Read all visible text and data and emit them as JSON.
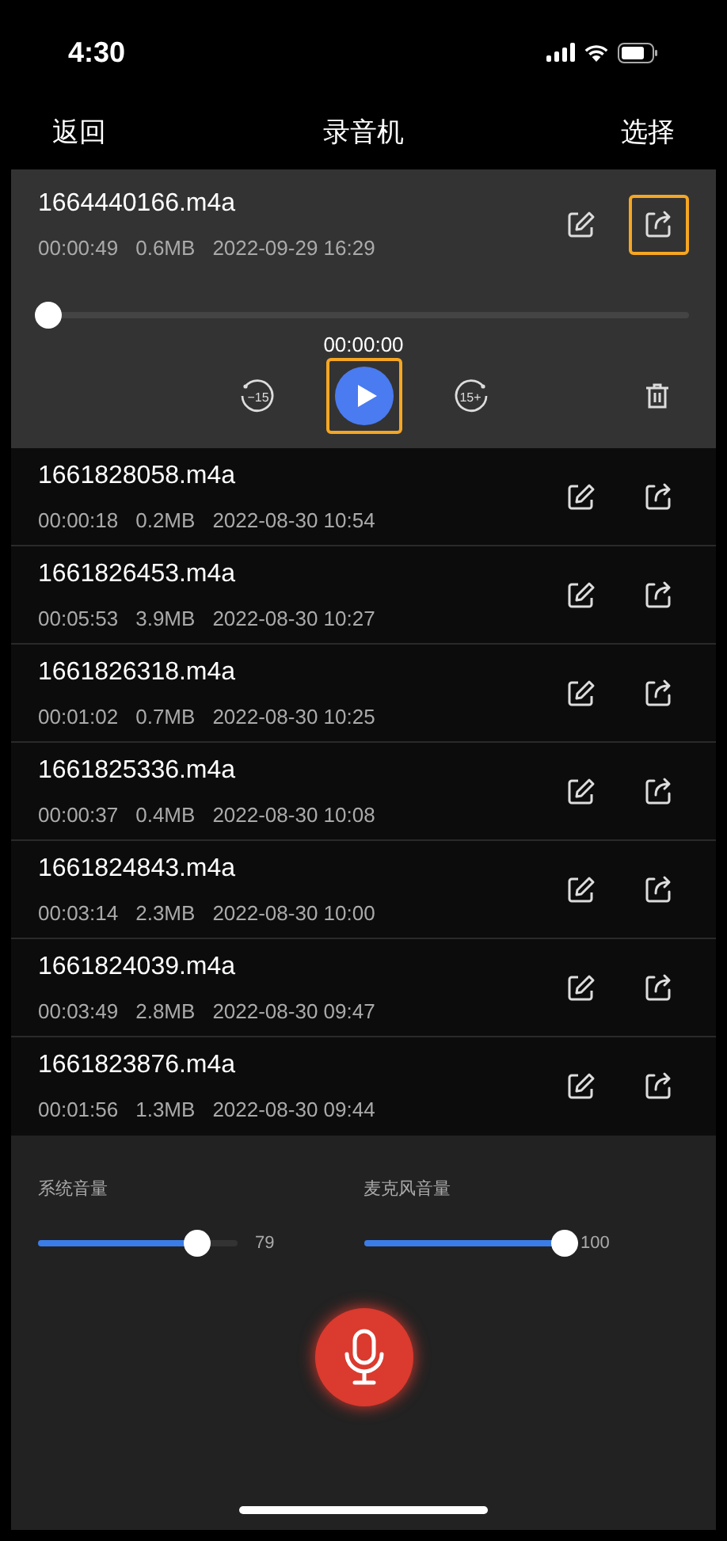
{
  "status_bar": {
    "time": "4:30"
  },
  "nav": {
    "back": "返回",
    "title": "录音机",
    "select": "选择"
  },
  "player": {
    "name": "1664440166.m4a",
    "duration": "00:00:49",
    "size": "0.6MB",
    "date": "2022-09-29 16:29",
    "level": 0,
    "position": "00:00:00",
    "rewind_label": "−15",
    "forward_label": "15+",
    "share_highlighted": true,
    "play_highlighted": true
  },
  "recordings": [
    {
      "name": "1661828058.m4a",
      "duration": "00:00:18",
      "size": "0.2MB",
      "date": "2022-08-30 10:54"
    },
    {
      "name": "1661826453.m4a",
      "duration": "00:05:53",
      "size": "3.9MB",
      "date": "2022-08-30 10:27"
    },
    {
      "name": "1661826318.m4a",
      "duration": "00:01:02",
      "size": "0.7MB",
      "date": "2022-08-30 10:25"
    },
    {
      "name": "1661825336.m4a",
      "duration": "00:00:37",
      "size": "0.4MB",
      "date": "2022-08-30 10:08"
    },
    {
      "name": "1661824843.m4a",
      "duration": "00:03:14",
      "size": "2.3MB",
      "date": "2022-08-30 10:00"
    },
    {
      "name": "1661824039.m4a",
      "duration": "00:03:49",
      "size": "2.8MB",
      "date": "2022-08-30 09:47"
    },
    {
      "name": "1661823876.m4a",
      "duration": "00:01:56",
      "size": "1.3MB",
      "date": "2022-08-30 09:44"
    }
  ],
  "volumes": [
    {
      "label": "系统音量",
      "level": 0.79,
      "reading": "79"
    },
    {
      "label": "麦克风音量",
      "level": 1,
      "reading": "100"
    }
  ]
}
